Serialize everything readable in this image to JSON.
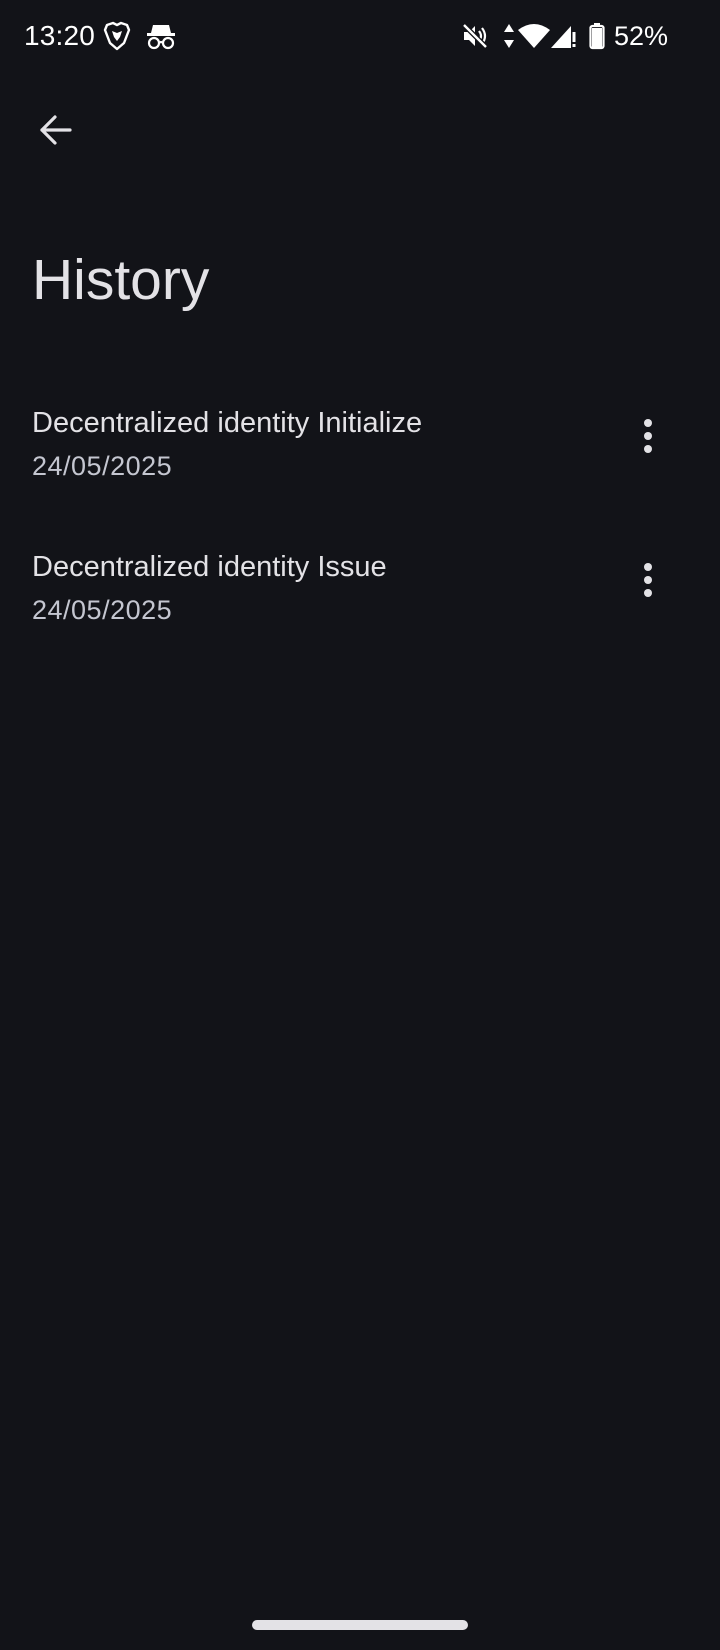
{
  "status_bar": {
    "time": "13:20",
    "battery_percent": "52%",
    "icons": [
      "brave-icon",
      "incognito-icon",
      "mute-icon",
      "data-arrows-icon",
      "wifi-icon",
      "signal-icon",
      "battery-icon"
    ]
  },
  "app_bar": {
    "back_icon": "arrow-back-icon"
  },
  "page": {
    "title": "History"
  },
  "history": {
    "items": [
      {
        "title": "Decentralized identity Initialize",
        "date": "24/05/2025",
        "menu_icon": "more-vert-icon"
      },
      {
        "title": "Decentralized identity Issue",
        "date": "24/05/2025",
        "menu_icon": "more-vert-icon"
      }
    ]
  },
  "colors": {
    "background": "#121318",
    "on_surface": "#e3e2e6",
    "on_surface_variant": "#c4c6d0"
  }
}
